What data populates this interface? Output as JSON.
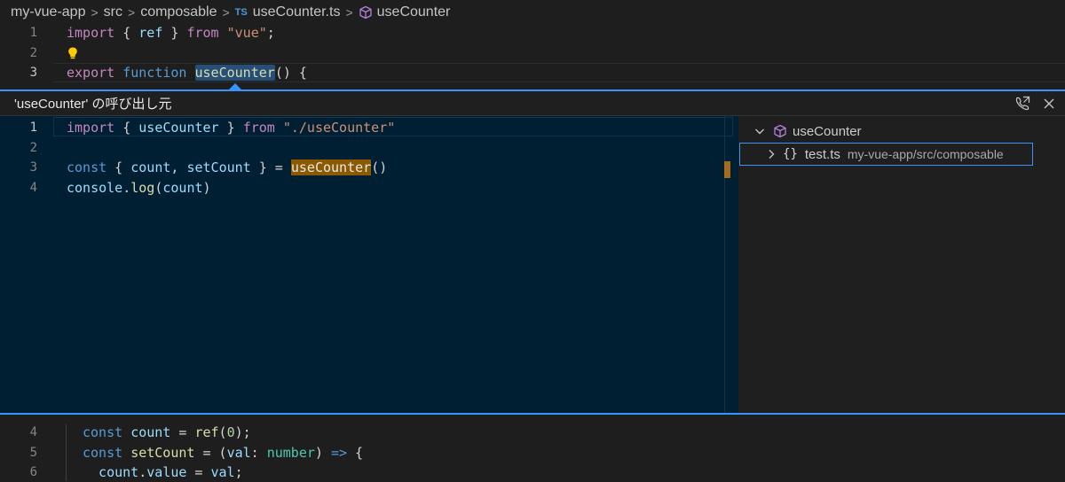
{
  "breadcrumb": {
    "items": [
      "my-vue-app",
      "src",
      "composable"
    ],
    "file_badge": "TS",
    "file": "useCounter.ts",
    "symbol": "useCounter"
  },
  "editor_top": {
    "lines": [
      {
        "n": "1",
        "tokens": [
          [
            "import",
            "kw"
          ],
          [
            " { ",
            "punc"
          ],
          [
            "ref",
            "var"
          ],
          [
            " } ",
            "punc"
          ],
          [
            "from",
            "kw"
          ],
          [
            " ",
            "punc"
          ],
          [
            "\"vue\"",
            "str"
          ],
          [
            ";",
            "punc"
          ]
        ]
      },
      {
        "n": "2",
        "lightbulb": true,
        "tokens": []
      },
      {
        "n": "3",
        "active": true,
        "tokens": [
          [
            "export",
            "kw"
          ],
          [
            " ",
            "punc"
          ],
          [
            "function",
            "kw2"
          ],
          [
            " ",
            "punc"
          ],
          [
            "useCounter",
            "fn hl-word"
          ],
          [
            "() {",
            "punc"
          ]
        ]
      }
    ]
  },
  "peek": {
    "title": "'useCounter' の呼び出し元",
    "lines": [
      {
        "n": "1",
        "active": true,
        "tokens": [
          [
            "import",
            "kw"
          ],
          [
            " { ",
            "punc"
          ],
          [
            "useCounter",
            "var"
          ],
          [
            " } ",
            "punc"
          ],
          [
            "from",
            "kw"
          ],
          [
            " ",
            "punc"
          ],
          [
            "\"./useCounter\"",
            "str"
          ]
        ]
      },
      {
        "n": "2",
        "tokens": []
      },
      {
        "n": "3",
        "tokens": [
          [
            "const",
            "kw2"
          ],
          [
            " { ",
            "punc"
          ],
          [
            "count",
            "var"
          ],
          [
            ", ",
            "punc"
          ],
          [
            "setCount",
            "var"
          ],
          [
            " } = ",
            "punc"
          ],
          [
            "useCounter",
            "fn hl-orange"
          ],
          [
            "()",
            "punc"
          ]
        ]
      },
      {
        "n": "4",
        "tokens": [
          [
            "console",
            "var"
          ],
          [
            ".",
            "punc"
          ],
          [
            "log",
            "fn"
          ],
          [
            "(",
            "punc"
          ],
          [
            "count",
            "var"
          ],
          [
            ")",
            "punc"
          ]
        ]
      }
    ],
    "tree": {
      "root_label": "useCounter",
      "child_label": "test.ts",
      "child_path": "my-vue-app/src/composable",
      "child_icon": "{}"
    }
  },
  "editor_bottom": {
    "lines": [
      {
        "n": "4",
        "tokens": [
          [
            "const",
            "kw2"
          ],
          [
            " ",
            "punc"
          ],
          [
            "count",
            "var"
          ],
          [
            " = ",
            "punc"
          ],
          [
            "ref",
            "fn"
          ],
          [
            "(",
            "punc"
          ],
          [
            "0",
            "num"
          ],
          [
            ");",
            "punc"
          ]
        ]
      },
      {
        "n": "5",
        "tokens": [
          [
            "const",
            "kw2"
          ],
          [
            " ",
            "punc"
          ],
          [
            "setCount",
            "fn"
          ],
          [
            " = (",
            "punc"
          ],
          [
            "val",
            "var"
          ],
          [
            ": ",
            "punc"
          ],
          [
            "number",
            "type"
          ],
          [
            ") ",
            "punc"
          ],
          [
            "=>",
            "kw2"
          ],
          [
            " {",
            "punc"
          ]
        ]
      },
      {
        "n": "6",
        "tokens": [
          [
            "  count",
            "var"
          ],
          [
            ".",
            "punc"
          ],
          [
            "value",
            "var"
          ],
          [
            " = ",
            "punc"
          ],
          [
            "val",
            "var"
          ],
          [
            ";",
            "punc"
          ]
        ]
      }
    ]
  }
}
